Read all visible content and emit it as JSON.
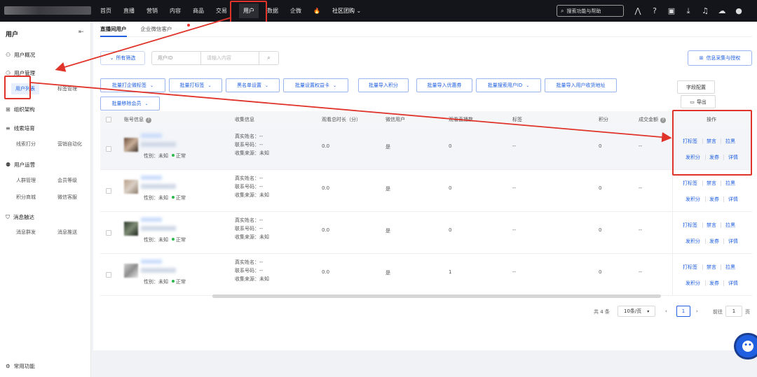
{
  "topnav": {
    "items": [
      "首页",
      "直播",
      "营销",
      "内容",
      "商品",
      "交易",
      "用户",
      "数据",
      "企微"
    ],
    "active": "用户",
    "community": "社区团购",
    "search_placeholder": "搜索功能与帮助"
  },
  "sidebar": {
    "title": "用户",
    "groups": [
      {
        "label": "用户概况",
        "icon": "overview-icon"
      },
      {
        "label": "用户管理",
        "icon": "user-manage-icon",
        "items": [
          "用户列表",
          "标签管理"
        ]
      },
      {
        "label": "组织架构",
        "icon": "org-icon"
      },
      {
        "label": "线索培育",
        "icon": "lead-icon",
        "items": [
          "线索打分",
          "营销自动化"
        ]
      },
      {
        "label": "用户运营",
        "icon": "ops-icon",
        "items": [
          "人群管理",
          "会员等级",
          "积分商城",
          "微信客服"
        ]
      },
      {
        "label": "消息触达",
        "icon": "message-icon",
        "items": [
          "消息群发",
          "消息推送"
        ]
      }
    ],
    "footer": "常用功能"
  },
  "tabs": [
    "直播间用户",
    "企业微信客户"
  ],
  "filter": {
    "all_filter": "所有筛选",
    "id_select": "用户ID",
    "input_placeholder": "请输入内容",
    "collect_button": "信息采集与授权"
  },
  "actions": [
    "批量打企微标签",
    "批量打标签",
    "黑名单设置",
    "批量设置权益卡",
    "批量导入积分",
    "批量导入优惠券",
    "批量搜索用户ID",
    "批量导入用户收货地址",
    "批量移除会员"
  ],
  "field_config": "字段配置",
  "export": "导出",
  "table": {
    "columns": [
      "账号信息",
      "收集信息",
      "观看总时长（分）",
      "微信用户",
      "观看直播数",
      "标签",
      "积分",
      "成交金额",
      "操作"
    ],
    "info_labels": [
      "真实姓名：--",
      "联系号码：--",
      "收集来源：未知"
    ],
    "gender": "性别：未知",
    "status": "正常",
    "ops": [
      "打标签",
      "禁言",
      "拉黑",
      "发积分",
      "发券",
      "详情"
    ],
    "rows": [
      {
        "duration": "0.0",
        "wechat": "是",
        "lives": "0",
        "tags": "--",
        "points": "0",
        "amount": "--"
      },
      {
        "duration": "0.0",
        "wechat": "是",
        "lives": "0",
        "tags": "--",
        "points": "0",
        "amount": "--"
      },
      {
        "duration": "0.0",
        "wechat": "是",
        "lives": "0",
        "tags": "--",
        "points": "0",
        "amount": "--"
      },
      {
        "duration": "0.0",
        "wechat": "是",
        "lives": "1",
        "tags": "--",
        "points": "0",
        "amount": "--"
      }
    ]
  },
  "pagination": {
    "total": "共 4 条",
    "page_size": "10条/页",
    "current": "1",
    "goto_label": "前往",
    "goto_value": "1",
    "page_suffix": "页"
  },
  "colors": {
    "accent": "#1f5fe0",
    "highlight": "#e0332a",
    "topbar": "#14151a"
  }
}
